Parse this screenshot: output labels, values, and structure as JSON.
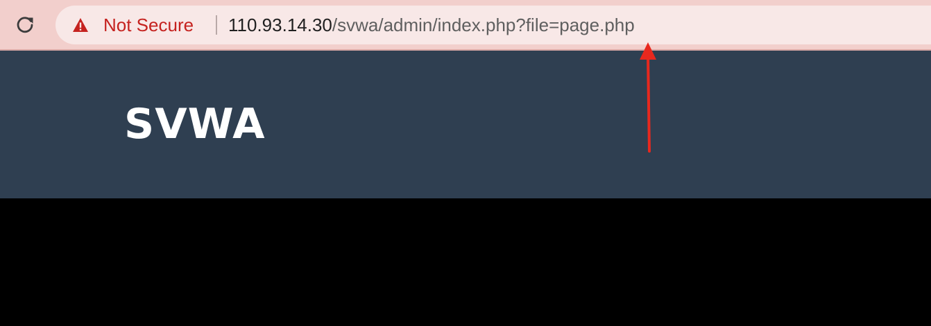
{
  "browser": {
    "reload_icon": "reload-icon",
    "security_icon": "warning-triangle-icon",
    "security_label": "Not Secure",
    "url_host": "110.93.14.30",
    "url_path": "/svwa/admin/index.php?file=page.php",
    "colors": {
      "toolbar_bg": "#f2cfcc",
      "omnibox_bg": "#f8e8e7",
      "warning": "#c5221f"
    }
  },
  "site": {
    "title": "SVWA",
    "colors": {
      "header_bg": "#2f3f51",
      "body_bg": "#000000"
    }
  },
  "annotation": {
    "type": "arrow",
    "color": "#e8281e",
    "points_to": "file=page.php"
  }
}
